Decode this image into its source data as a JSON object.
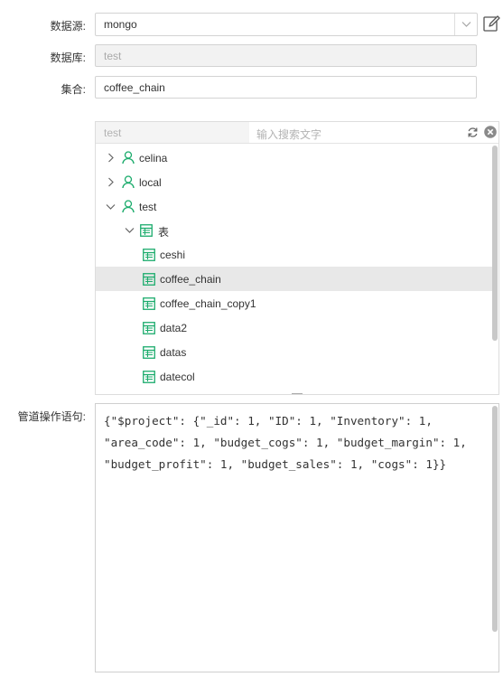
{
  "form": {
    "datasource_label": "数据源:",
    "datasource_value": "mongo",
    "database_label": "数据库:",
    "database_value": "test",
    "collection_label": "集合:",
    "collection_value": "coffee_chain",
    "pipeline_label": "管道操作语句:"
  },
  "tree": {
    "db_filter": "test",
    "search_placeholder": "输入搜索文字",
    "nodes": [
      {
        "label": "celina",
        "icon": "user-icon",
        "expanded": false
      },
      {
        "label": "local",
        "icon": "user-icon",
        "expanded": false
      },
      {
        "label": "test",
        "icon": "user-icon",
        "expanded": true
      },
      {
        "label": "表",
        "icon": "table-icon",
        "expanded": true
      },
      {
        "label": "ceshi",
        "icon": "table-icon"
      },
      {
        "label": "coffee_chain",
        "icon": "table-icon",
        "selected": true
      },
      {
        "label": "coffee_chain_copy1",
        "icon": "table-icon"
      },
      {
        "label": "data2",
        "icon": "table-icon"
      },
      {
        "label": "datas",
        "icon": "table-icon"
      },
      {
        "label": "datecol",
        "icon": "table-icon"
      }
    ]
  },
  "pipeline": {
    "code": "{\"$project\": {\"_id\": 1, \"ID\": 1, \"Inventory\": 1,\n\"area_code\": 1, \"budget_cogs\": 1, \"budget_margin\": 1,\n\"budget_profit\": 1, \"budget_sales\": 1, \"cogs\": 1}}"
  },
  "colors": {
    "accent_green": "#1aab6b",
    "selected_row": "#e8e8e8"
  }
}
